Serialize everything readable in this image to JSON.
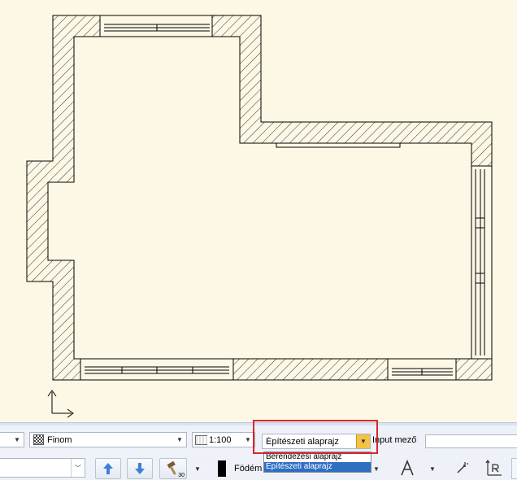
{
  "toolbar": {
    "detail_combo": {
      "value": "Finom"
    },
    "scale_combo": {
      "value": "1:100"
    },
    "layer_combo": {
      "value": "Építészeti alaprajz"
    },
    "input_label": "Input mező",
    "input_value": "",
    "material_label": "Födém",
    "hammer_badge": "30"
  },
  "layer_dropdown": {
    "options": [
      "Berendezési alaprajz",
      "Építészeti alaprajz"
    ],
    "selected": 1
  },
  "colors": {
    "highlight": "#d9262d",
    "selection": "#2f6fc1",
    "canvas": "#fdf7e6"
  }
}
